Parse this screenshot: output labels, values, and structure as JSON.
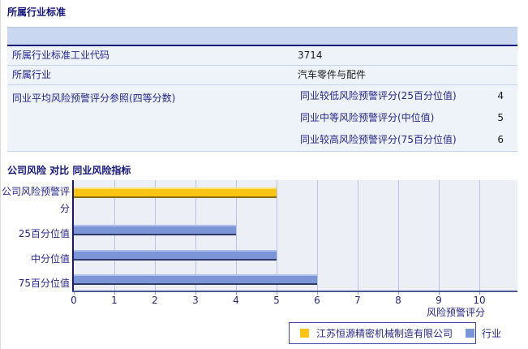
{
  "section1": {
    "title": "所属行业标准",
    "table": {
      "rows": [
        {
          "label": "所属行业标准工业代码",
          "value": "3714"
        },
        {
          "label": "所属行业",
          "value": "汽车零件与配件"
        },
        {
          "label": "同业平均风险预警评分参照(四等分数)",
          "sub_rows": [
            {
              "label": "同业较低风险预警评分(25百分位值)",
              "value": "4"
            },
            {
              "label": "同业中等风险预警评分(中位值)",
              "value": "5"
            },
            {
              "label": "同业较高风险预警评分(75百分位值)",
              "value": "6"
            }
          ]
        }
      ]
    }
  },
  "section2": {
    "title": "公司风险 对比 同业风险指标"
  },
  "chart_data": {
    "type": "bar",
    "orientation": "horizontal",
    "title": "公司风险 对比 同业风险指标",
    "xlabel": "风险预警评分",
    "xlim": [
      0,
      10
    ],
    "x_ticks": [
      "0",
      "1",
      "2",
      "3",
      "4",
      "5",
      "6",
      "7",
      "8",
      "9",
      "10"
    ],
    "grid": true,
    "categories": [
      "公司风险预警评分",
      "25百分位值",
      "中分位值",
      "75百分位值"
    ],
    "values": [
      5,
      4,
      5,
      6
    ],
    "bar_colors": [
      "#FFC413",
      "#7B95D6",
      "#7B95D6",
      "#7B95D6"
    ],
    "series": [
      {
        "name": "江苏恒源精密机械制造有限公司",
        "color": "#FFC413",
        "categories": [
          "公司风险预警评分"
        ],
        "values": [
          5
        ]
      },
      {
        "name": "行业",
        "color": "#7B95D6",
        "categories": [
          "25百分位值",
          "中分位值",
          "75百分位值"
        ],
        "values": [
          4,
          5,
          6
        ]
      }
    ],
    "legend": {
      "position": "bottom",
      "entries": [
        {
          "label": "江苏恒源精密机械制造有限公司",
          "color": "#FFC413"
        },
        {
          "label": "行业",
          "color": "#7B95D6"
        }
      ]
    }
  },
  "colors": {
    "title_text": "#15157B",
    "table_header_band": "#C9D8F0",
    "row_background": "#EEF2F9",
    "plot_background": "#ECEFF6",
    "gridline": "#B5C4E6",
    "company_bar": "#FFC413",
    "industry_bar": "#7B95D6"
  }
}
